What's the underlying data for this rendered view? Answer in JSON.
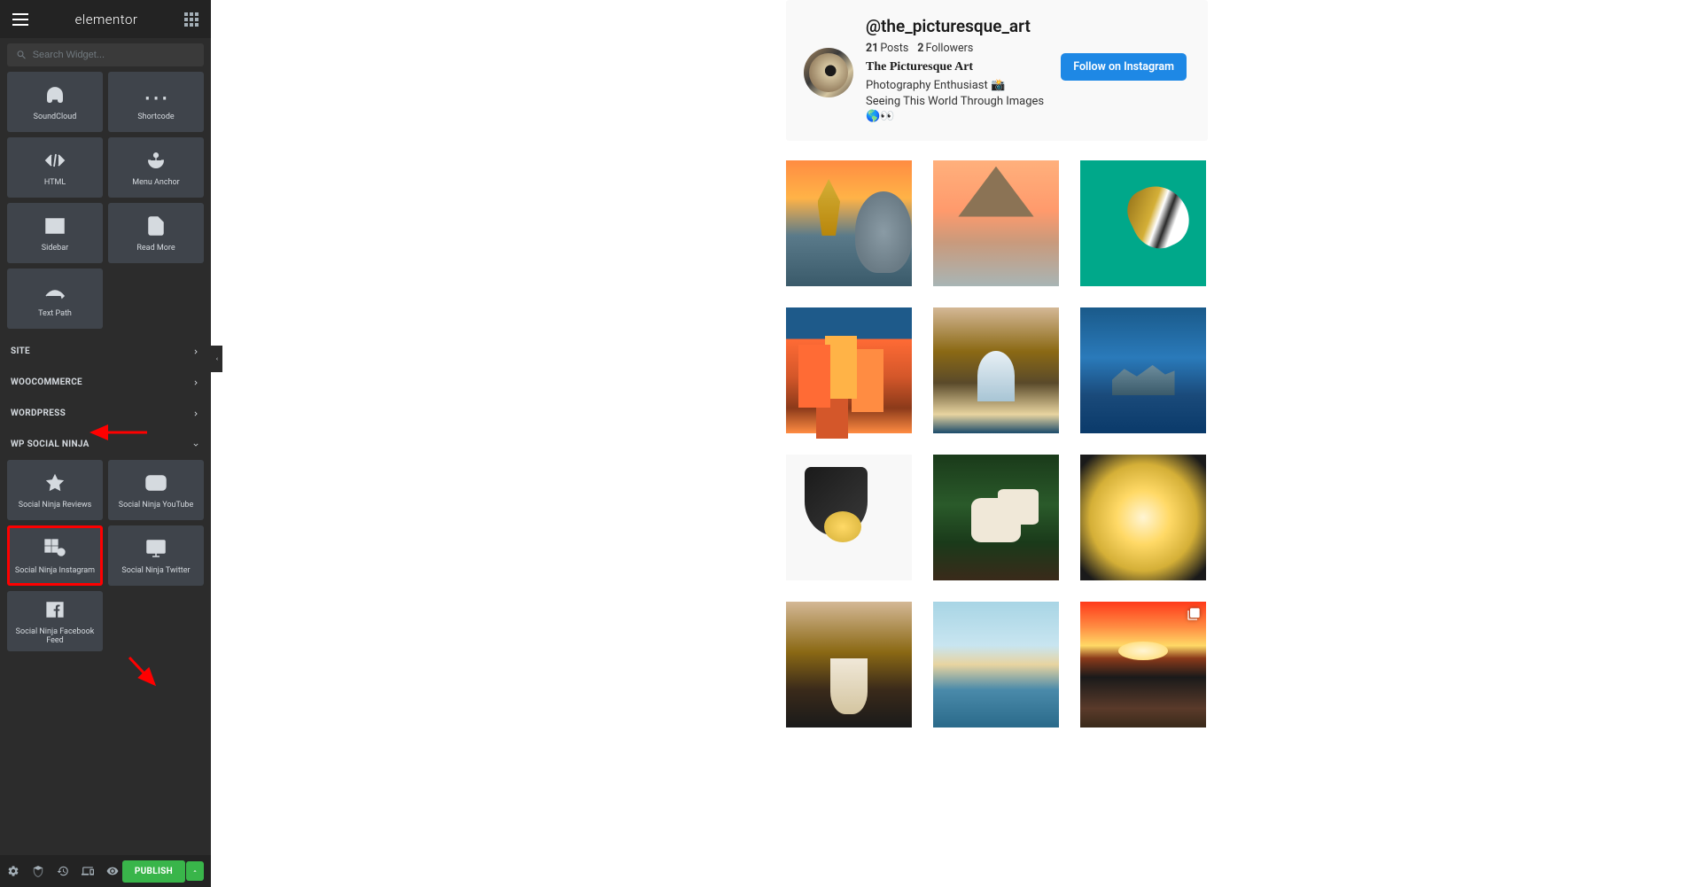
{
  "sidebar": {
    "logo": "elementor",
    "search_placeholder": "Search Widget...",
    "widgets_general": [
      {
        "label": "SoundCloud",
        "icon": "headphones"
      },
      {
        "label": "Shortcode",
        "icon": "brackets"
      },
      {
        "label": "HTML",
        "icon": "code"
      },
      {
        "label": "Menu Anchor",
        "icon": "anchor"
      },
      {
        "label": "Sidebar",
        "icon": "sidebar"
      },
      {
        "label": "Read More",
        "icon": "page"
      },
      {
        "label": "Text Path",
        "icon": "textpath"
      }
    ],
    "categories": [
      {
        "label": "SITE",
        "open": false
      },
      {
        "label": "WOOCOMMERCE",
        "open": false
      },
      {
        "label": "WORDPRESS",
        "open": false
      },
      {
        "label": "WP SOCIAL NINJA",
        "open": true
      }
    ],
    "widgets_social": [
      {
        "label": "Social Ninja Reviews",
        "icon": "star"
      },
      {
        "label": "Social Ninja YouTube",
        "icon": "youtube"
      },
      {
        "label": "Social Ninja Instagram",
        "icon": "instagram",
        "highlighted": true
      },
      {
        "label": "Social Ninja Twitter",
        "icon": "twitter"
      },
      {
        "label": "Social Ninja Facebook Feed",
        "icon": "facebook"
      }
    ],
    "publish_label": "PUBLISH"
  },
  "profile": {
    "handle": "@the_picturesque_art",
    "posts_count": "21",
    "posts_label": "Posts",
    "followers_count": "2",
    "followers_label": "Followers",
    "display_name": "The Picturesque Art",
    "bio_line1": "Photography Enthusiast 📸",
    "bio_line2": "Seeing This World Through Images",
    "bio_line3": "🌎👀",
    "follow_label": "Follow on Instagram"
  },
  "feed": {
    "items": [
      {
        "desc": "golden-angel-statue-dome-sunset"
      },
      {
        "desc": "tiki-hut-beach-sunset"
      },
      {
        "desc": "puffin-bird-teal-background"
      },
      {
        "desc": "colorful-italian-village-buildings"
      },
      {
        "desc": "sea-arch-cave-beach"
      },
      {
        "desc": "aerial-rocky-islands-blue-ocean"
      },
      {
        "desc": "black-desk-lamp-warm-light"
      },
      {
        "desc": "ceramic-animal-figurines-green-leaves"
      },
      {
        "desc": "skillet-cheese-dish-food"
      },
      {
        "desc": "iced-coffee-dessert-glass"
      },
      {
        "desc": "person-walking-beach-distant"
      },
      {
        "desc": "dramatic-red-sunset-rocky-coast",
        "carousel": true
      }
    ]
  },
  "colors": {
    "sidebar_bg": "#2c2c2c",
    "accent_green": "#39b54a",
    "highlight_red": "#ff0000",
    "instagram_blue": "#1e88e5"
  }
}
